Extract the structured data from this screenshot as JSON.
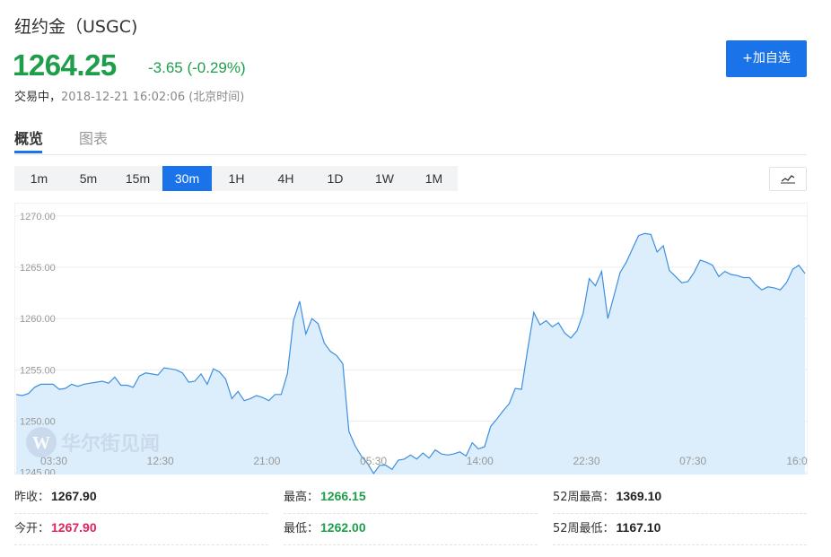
{
  "header": {
    "title": "纽约金（USGC)",
    "price": "1264.25",
    "change": "-3.65 (-0.29%)",
    "status_label": "交易中，",
    "timestamp": "2018-12-21 16:02:06 (北京时间)",
    "add_button": "+加自选"
  },
  "tabs": [
    "概览",
    "图表"
  ],
  "periods": [
    "1m",
    "5m",
    "15m",
    "30m",
    "1H",
    "4H",
    "1D",
    "1W",
    "1M"
  ],
  "active_period": "30m",
  "chart_type_icon": "line-chart-icon",
  "watermark": "华尔街见闻",
  "colors": {
    "up_down_green": "#1e9e4b",
    "accent": "#1a73e8",
    "red": "#e0245e",
    "area_fill": "#dcedfc",
    "line": "#3d8fe0"
  },
  "chart_data": {
    "type": "area",
    "x_tick_labels": [
      "03:30",
      "12:30",
      "21:00",
      "05:30",
      "14:00",
      "22:30",
      "07:30",
      "16:0"
    ],
    "y_tick_labels": [
      "1270.00",
      "1265.00",
      "1260.00",
      "1255.00",
      "1250.00",
      "1245.00"
    ],
    "ylim": [
      1244.8,
      1271.3
    ],
    "grid": true,
    "values": [
      1252.6,
      1252.5,
      1252.7,
      1253.3,
      1253.6,
      1253.6,
      1253.6,
      1253.1,
      1253.2,
      1253.6,
      1253.4,
      1253.6,
      1253.7,
      1253.8,
      1253.9,
      1253.7,
      1254.3,
      1253.5,
      1253.5,
      1253.3,
      1254.4,
      1254.7,
      1254.6,
      1254.5,
      1255.2,
      1255.1,
      1255.0,
      1254.7,
      1253.8,
      1253.9,
      1254.6,
      1253.6,
      1255.1,
      1254.8,
      1254.1,
      1252.2,
      1252.9,
      1252.0,
      1252.2,
      1252.5,
      1252.3,
      1252.0,
      1252.6,
      1252.6,
      1254.6,
      1259.8,
      1261.7,
      1258.5,
      1260.0,
      1259.5,
      1257.6,
      1256.8,
      1256.4,
      1255.6,
      1249.0,
      1247.6,
      1246.6,
      1245.9,
      1244.9,
      1245.7,
      1245.7,
      1245.3,
      1246.2,
      1246.3,
      1246.7,
      1246.3,
      1246.9,
      1246.4,
      1247.2,
      1246.8,
      1246.7,
      1246.8,
      1247.0,
      1246.6,
      1247.9,
      1247.3,
      1247.5,
      1249.5,
      1250.2,
      1251.0,
      1251.7,
      1253.2,
      1253.1,
      1257.0,
      1260.6,
      1259.4,
      1259.8,
      1259.2,
      1259.6,
      1258.6,
      1258.1,
      1258.8,
      1260.5,
      1263.9,
      1263.2,
      1264.6,
      1260.0,
      1262.2,
      1264.5,
      1265.5,
      1266.8,
      1268.1,
      1268.3,
      1268.2,
      1266.5,
      1267.1,
      1264.7,
      1264.1,
      1263.5,
      1263.6,
      1264.5,
      1265.7,
      1265.5,
      1265.2,
      1264.1,
      1264.6,
      1264.3,
      1264.2,
      1264.0,
      1264.0,
      1263.3,
      1262.8,
      1263.1,
      1263.0,
      1262.8,
      1263.5,
      1264.8,
      1265.2,
      1264.4
    ]
  },
  "stats": [
    {
      "label": "昨收：",
      "value": "1267.90",
      "color": ""
    },
    {
      "label": "最高：",
      "value": "1266.15",
      "color": "green"
    },
    {
      "label": "52周最高：",
      "value": "1369.10",
      "color": ""
    },
    {
      "label": "今开：",
      "value": "1267.90",
      "color": "red"
    },
    {
      "label": "最低：",
      "value": "1262.00",
      "color": "green"
    },
    {
      "label": "52周最低：",
      "value": "1167.10",
      "color": ""
    }
  ]
}
